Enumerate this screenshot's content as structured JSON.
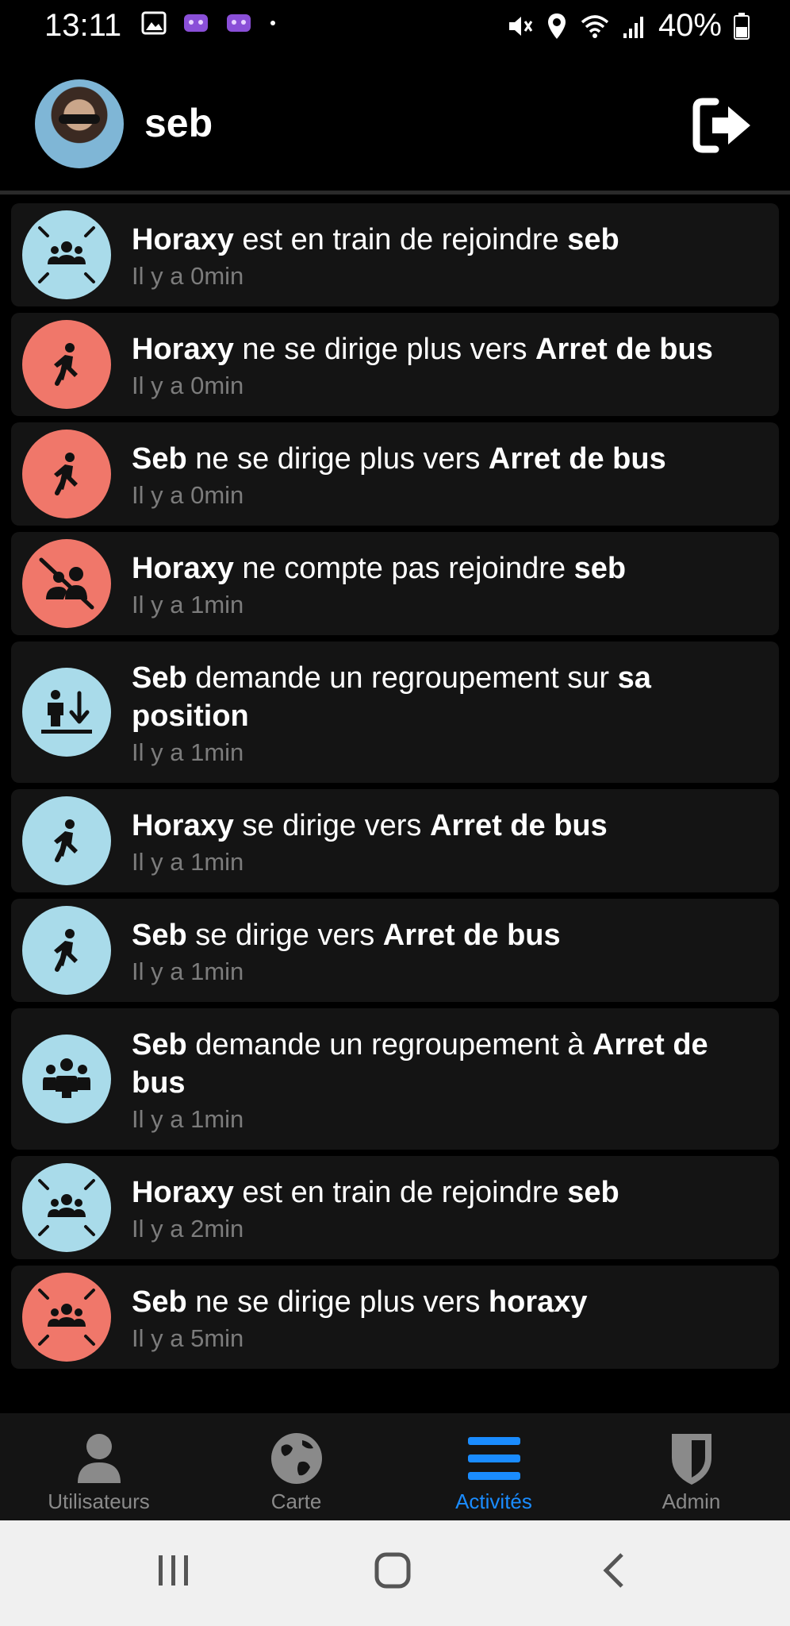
{
  "status_bar": {
    "time": "13:11",
    "battery": "40%",
    "left_icons": [
      "image-icon",
      "app-icon",
      "app-icon",
      "dot-icon"
    ],
    "right_icons": [
      "mute-icon",
      "location-icon",
      "wifi-icon",
      "signal-icon",
      "battery-icon"
    ]
  },
  "header": {
    "username": "seb",
    "logout_icon": "logout-icon"
  },
  "colors": {
    "icon_blue": "#a9dbea",
    "icon_red": "#f0776a",
    "active_tab": "#1a8cff"
  },
  "activities": [
    {
      "parts": [
        {
          "t": "Horaxy",
          "b": true
        },
        {
          "t": " est en train de rejoindre ",
          "b": false
        },
        {
          "t": "seb",
          "b": true
        }
      ],
      "time": "Il y a 0min",
      "icon": "group-join-icon",
      "color": "blue"
    },
    {
      "parts": [
        {
          "t": "Horaxy",
          "b": true
        },
        {
          "t": " ne se dirige plus vers ",
          "b": false
        },
        {
          "t": "Arret de bus",
          "b": true
        }
      ],
      "time": "Il y a 0min",
      "icon": "walking-icon",
      "color": "red"
    },
    {
      "parts": [
        {
          "t": "Seb",
          "b": true
        },
        {
          "t": " ne se dirige plus vers ",
          "b": false
        },
        {
          "t": "Arret de bus",
          "b": true
        }
      ],
      "time": "Il y a 0min",
      "icon": "walking-icon",
      "color": "red"
    },
    {
      "parts": [
        {
          "t": "Horaxy",
          "b": true
        },
        {
          "t": " ne compte pas rejoindre ",
          "b": false
        },
        {
          "t": "seb",
          "b": true
        }
      ],
      "time": "Il y a 1min",
      "icon": "group-off-icon",
      "color": "red"
    },
    {
      "parts": [
        {
          "t": "Seb",
          "b": true
        },
        {
          "t": " demande un regroupement sur ",
          "b": false
        },
        {
          "t": "sa position",
          "b": true
        }
      ],
      "time": "Il y a 1min",
      "icon": "regroup-here-icon",
      "color": "blue"
    },
    {
      "parts": [
        {
          "t": "Horaxy",
          "b": true
        },
        {
          "t": " se dirige vers ",
          "b": false
        },
        {
          "t": "Arret de bus",
          "b": true
        }
      ],
      "time": "Il y a 1min",
      "icon": "walking-icon",
      "color": "blue"
    },
    {
      "parts": [
        {
          "t": "Seb",
          "b": true
        },
        {
          "t": " se dirige vers ",
          "b": false
        },
        {
          "t": "Arret de bus",
          "b": true
        }
      ],
      "time": "Il y a 1min",
      "icon": "walking-icon",
      "color": "blue"
    },
    {
      "parts": [
        {
          "t": "Seb",
          "b": true
        },
        {
          "t": " demande un regroupement à ",
          "b": false
        },
        {
          "t": "Arret de bus",
          "b": true
        }
      ],
      "time": "Il y a 1min",
      "icon": "group-icon",
      "color": "blue"
    },
    {
      "parts": [
        {
          "t": "Horaxy",
          "b": true
        },
        {
          "t": " est en train de rejoindre ",
          "b": false
        },
        {
          "t": "seb",
          "b": true
        }
      ],
      "time": "Il y a 2min",
      "icon": "group-join-icon",
      "color": "blue"
    },
    {
      "parts": [
        {
          "t": "Seb",
          "b": true
        },
        {
          "t": " ne se dirige plus vers ",
          "b": false
        },
        {
          "t": "horaxy",
          "b": true
        }
      ],
      "time": "Il y a 5min",
      "icon": "group-join-icon",
      "color": "red"
    }
  ],
  "bottom_nav": [
    {
      "label": "Utilisateurs",
      "icon": "user-icon",
      "active": false
    },
    {
      "label": "Carte",
      "icon": "globe-icon",
      "active": false
    },
    {
      "label": "Activités",
      "icon": "list-icon",
      "active": true
    },
    {
      "label": "Admin",
      "icon": "shield-icon",
      "active": false
    }
  ],
  "system_nav": [
    "recent-apps-icon",
    "home-icon",
    "back-icon"
  ]
}
